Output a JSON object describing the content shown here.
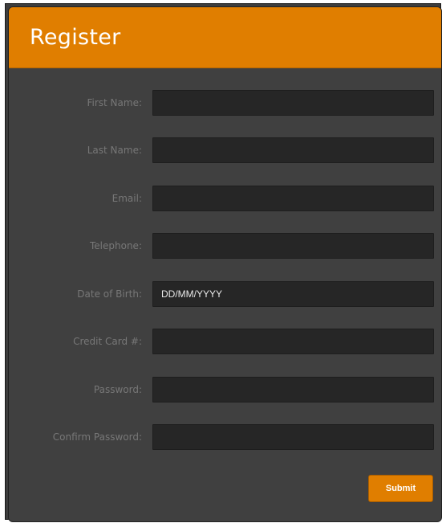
{
  "form": {
    "title": "Register",
    "fields": [
      {
        "label": "First Name:",
        "value": "",
        "placeholder": ""
      },
      {
        "label": "Last Name:",
        "value": "",
        "placeholder": ""
      },
      {
        "label": "Email:",
        "value": "",
        "placeholder": ""
      },
      {
        "label": "Telephone:",
        "value": "",
        "placeholder": ""
      },
      {
        "label": "Date of Birth:",
        "value": "",
        "placeholder": "DD/MM/YYYY"
      },
      {
        "label": "Credit Card #:",
        "value": "",
        "placeholder": ""
      },
      {
        "label": "Password:",
        "value": "",
        "placeholder": ""
      },
      {
        "label": "Confirm Password:",
        "value": "",
        "placeholder": ""
      }
    ],
    "submit_label": "Submit"
  },
  "colors": {
    "accent": "#e07e00",
    "panel_bg": "#404040",
    "field_bg": "#262626",
    "label_text": "#777777"
  }
}
